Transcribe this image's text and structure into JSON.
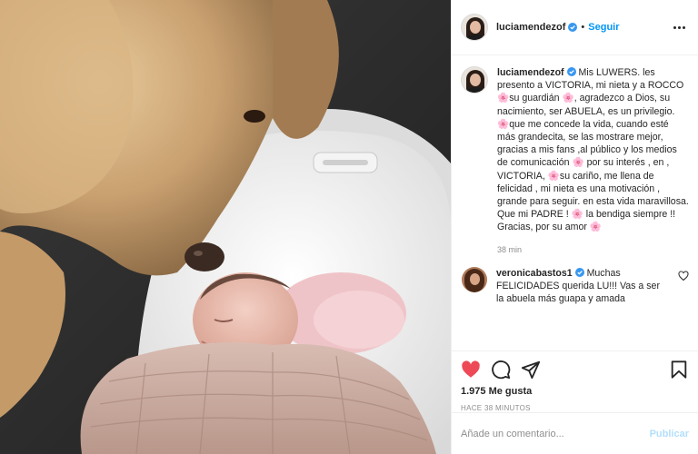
{
  "post": {
    "author": {
      "username": "luciamendezof",
      "verified_icon": "verified-badge-icon",
      "follow_label": "Seguir",
      "separator": "•"
    },
    "caption": {
      "username": "luciamendezof",
      "text": " Mis LUWERS. les presento a VICTORIA, mi nieta y a ROCCO🌸su guardián 🌸, agradezco a Dios, su nacimiento, ser ABUELA, es un privilegio. 🌸que me concede la vida, cuando esté más grandecita, se las mostrare mejor, gracias a mis fans ,al público y los medios de comunicación 🌸 por su interés , en , VICTORIA, 🌸su cariño, me llena de felicidad , mi nieta es una motivación , grande para seguir. en esta vida maravillosa. Que mi PADRE ! 🌸 la bendiga siempre !! Gracias, por su amor 🌸",
      "time": "38 min"
    },
    "comments": [
      {
        "username": "veronicabastos1",
        "text": " Muchas FELICIDADES querida LU!!! Vas a ser la abuela más guapa y amada"
      }
    ],
    "actions": {
      "icons": [
        "heart-icon",
        "comment-icon",
        "share-icon",
        "bookmark-icon"
      ],
      "likes": "1.975 Me gusta",
      "time_ago": "HACE 38 MINUTOS"
    },
    "add_comment": {
      "placeholder": "Añade un comentario...",
      "publish_label": "Publicar"
    }
  },
  "colors": {
    "link_blue": "#0095f6",
    "publish_disabled": "#b2dffc",
    "verified_blue": "#3897f0",
    "like_red": "#ed4956",
    "muted": "#8e8e8e"
  }
}
